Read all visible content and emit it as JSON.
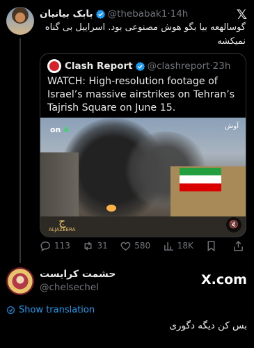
{
  "post": {
    "author_name": "بابک بیانیان",
    "handle": "@thebabak1",
    "time": "14h",
    "text": "گوسالهعه بیا بگو هوش مصنوعی بود. اسراییل بی گناه نمیکشه",
    "platform_icon": "x-logo-icon"
  },
  "quote": {
    "author_name": "Clash Report",
    "handle": "@clashreport",
    "time": "23h",
    "text": "WATCH: High-resolution footage of Israel’s massive airstrikes on Tehran’s Tajrish Square on June 15.",
    "media": {
      "channel_badge_prefix": "on",
      "channel_badge_number": "4",
      "channel_logo": "آوش",
      "source_logo": "ALJAZEERA",
      "mute_icon": "mute-icon"
    }
  },
  "actions": {
    "replies": "113",
    "reposts": "31",
    "likes": "580",
    "views": "18K"
  },
  "reply": {
    "author_name": "حشمت کرایست",
    "handle": "@chelsechel",
    "watermark": "X.com",
    "show_translation": "Show translation",
    "text": "بس کن دیگه دگوری"
  },
  "colors": {
    "background": "#000000",
    "text": "#e7e9ea",
    "muted": "#71767b",
    "accent": "#1d9bf0",
    "border": "#333639"
  }
}
